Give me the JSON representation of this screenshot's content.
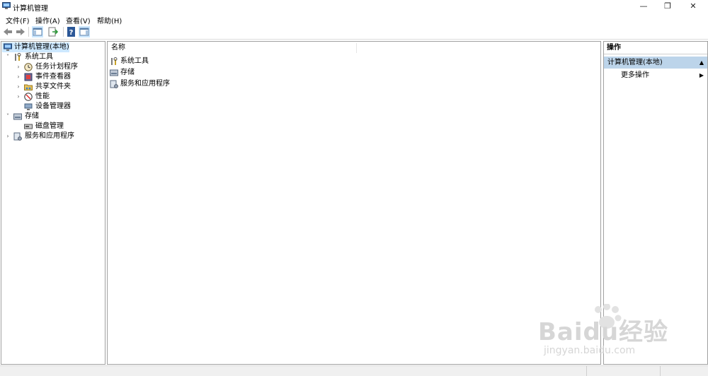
{
  "window": {
    "title": "计算机管理"
  },
  "menu": [
    "文件(F)",
    "操作(A)",
    "查看(V)",
    "帮助(H)"
  ],
  "tree": {
    "root": "计算机管理(本地)",
    "system_tools": "系统工具",
    "task_scheduler": "任务计划程序",
    "event_viewer": "事件查看器",
    "shared_folders": "共享文件夹",
    "performance": "性能",
    "device_manager": "设备管理器",
    "storage": "存储",
    "disk_management": "磁盘管理",
    "services_apps": "服务和应用程序"
  },
  "list": {
    "header": "名称",
    "items": [
      "系统工具",
      "存储",
      "服务和应用程序"
    ]
  },
  "actions": {
    "title": "操作",
    "section": "计算机管理(本地)",
    "more": "更多操作"
  },
  "watermark": {
    "brand": "Baidu经验",
    "url": "jingyan.baidu.com"
  },
  "colors": {
    "selection": "#cde8ff",
    "action_section": "#bcd4ea"
  }
}
